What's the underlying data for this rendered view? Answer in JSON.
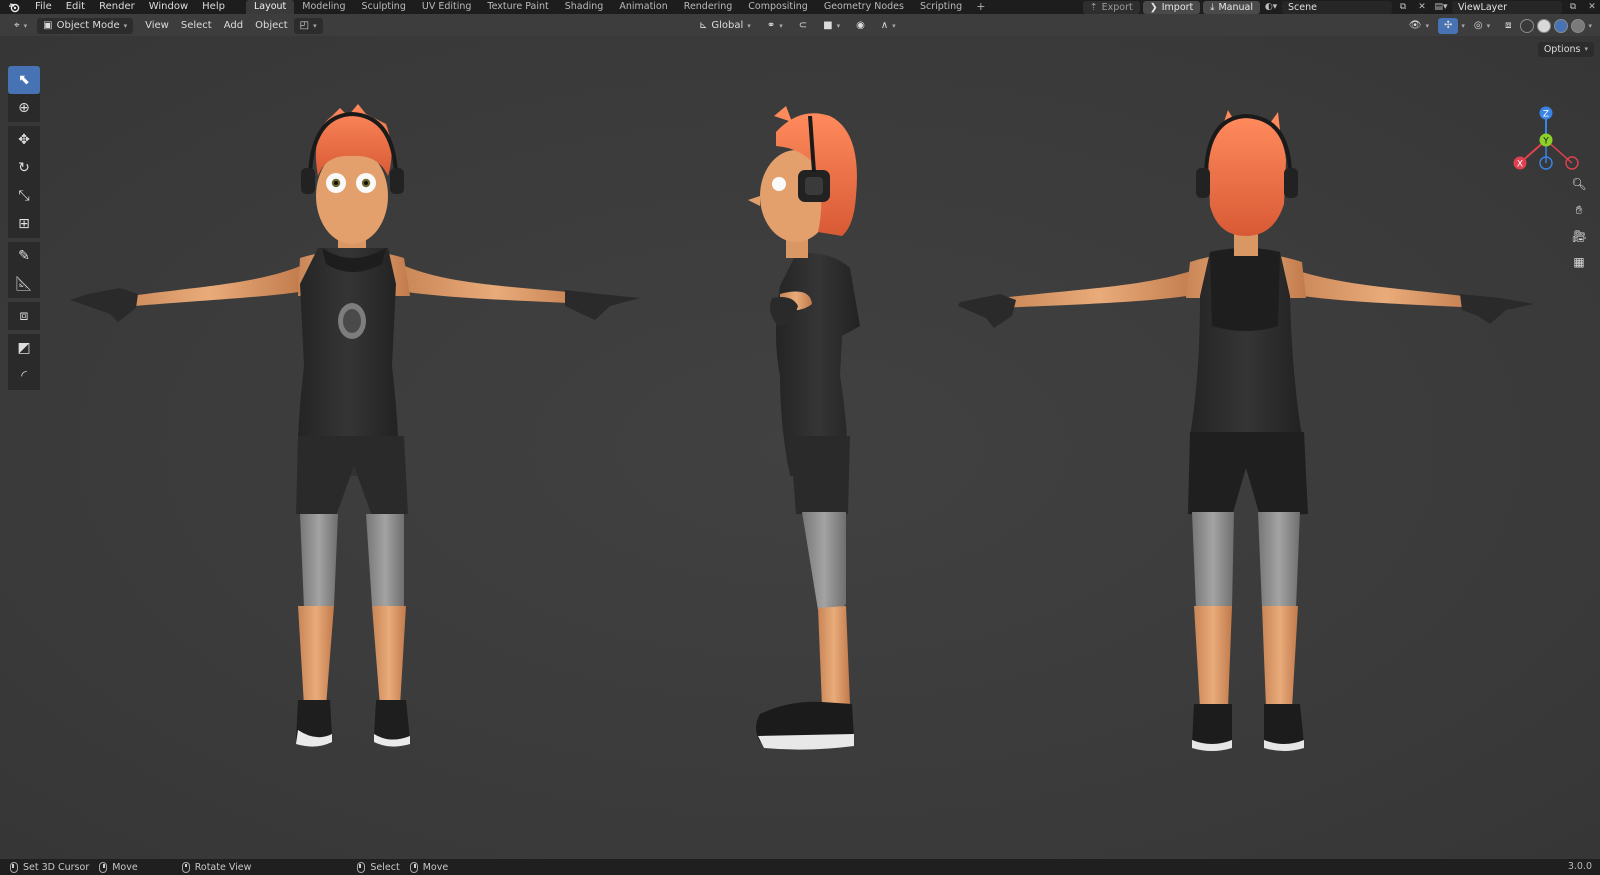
{
  "topbar": {
    "logo_icon": "blender-logo-icon",
    "menus": [
      "File",
      "Edit",
      "Render",
      "Window",
      "Help"
    ],
    "workspaces": [
      "Layout",
      "Modeling",
      "Sculpting",
      "UV Editing",
      "Texture Paint",
      "Shading",
      "Animation",
      "Rendering",
      "Compositing",
      "Geometry Nodes",
      "Scripting"
    ],
    "active_workspace": "Layout",
    "add_workspace": "+",
    "export_label": "Export",
    "import_label": "Import",
    "manual_label": "Manual",
    "scene_name": "Scene",
    "viewlayer_name": "ViewLayer"
  },
  "viewport_header": {
    "mode": "Object Mode",
    "menus": [
      "View",
      "Select",
      "Add",
      "Object"
    ],
    "orientation": "Global",
    "options_label": "Options"
  },
  "toolbar": {
    "tools": [
      "select-box-icon",
      "cursor-icon",
      "move-icon",
      "rotate-icon",
      "scale-icon",
      "transform-icon",
      "annotate-icon",
      "measure-icon",
      "add-cube-icon",
      "extrude-icon",
      "bevel-icon"
    ],
    "active_tool": "select-box-icon"
  },
  "gizmo": {
    "x_label": "X",
    "y_label": "Y",
    "z_label": "Z",
    "x_color": "#e0414f",
    "y_color": "#8cd02a",
    "z_color": "#3a84e6"
  },
  "statusbar": {
    "items": [
      {
        "mouse": "left",
        "label": "Set 3D Cursor"
      },
      {
        "mouse": "right",
        "label": "Move"
      },
      {
        "mouse": "middle",
        "label": "Rotate View"
      },
      {
        "mouse": "left",
        "label": "Select"
      },
      {
        "mouse": "right",
        "label": "Move"
      }
    ],
    "version": "3.0.0"
  },
  "colors": {
    "accent": "#4772b3",
    "background": "#3d3d3d",
    "hair": "#f07a50",
    "skin": "#e6a574",
    "clothes": "#2b2b2b",
    "leggings": "#8f8f8f"
  }
}
